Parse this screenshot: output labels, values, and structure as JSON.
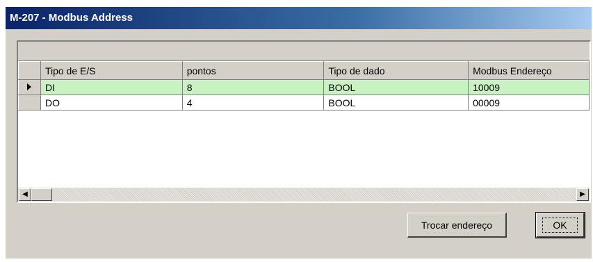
{
  "window": {
    "title": "M-207 - Modbus Address"
  },
  "grid": {
    "columns": [
      "Tipo de E/S",
      "pontos",
      "Tipo de dado",
      "Modbus Endereço"
    ],
    "rows": [
      {
        "tipo_es": "DI",
        "pontos": "8",
        "tipo_dado": "BOOL",
        "endereco": "10009",
        "selected": true
      },
      {
        "tipo_es": "DO",
        "pontos": "4",
        "tipo_dado": "BOOL",
        "endereco": "00009",
        "selected": false
      }
    ],
    "row_indicator_icon": "row-pointer-icon"
  },
  "buttons": {
    "swap_label": "Trocar endereço",
    "ok_label": "OK"
  },
  "colors": {
    "selected_row": "#c9f2c3",
    "title_start": "#0a246a",
    "title_end": "#a6caf0",
    "face": "#d4d0c8"
  }
}
